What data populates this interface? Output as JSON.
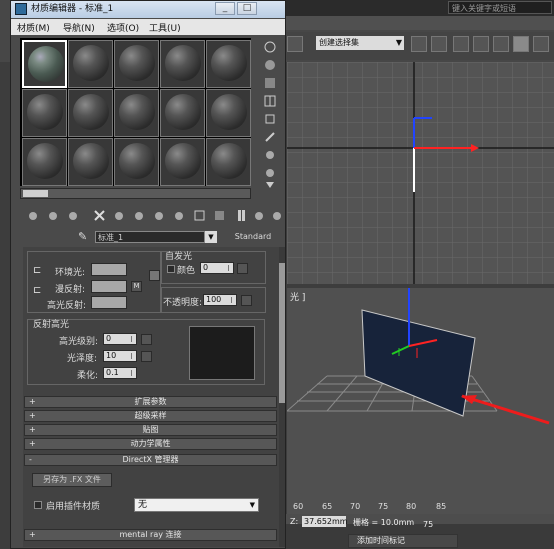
{
  "background": {
    "search_placeholder": "键入关键字或短语",
    "selection_set": "创建选择集",
    "viewport_label": "光 ]",
    "timeline_ticks": [
      "60",
      "65",
      "70",
      "75",
      "80",
      "85"
    ],
    "coord_label": "Z:",
    "coord_value": "37.652mm",
    "grid_label": "栅格 = 10.0mm",
    "add_time_tag": "添加时间标记",
    "extra_tick": "75"
  },
  "material_editor": {
    "title": "材质编辑器 - 标准_1",
    "window_buttons": [
      "_",
      "□"
    ],
    "menus": [
      "材质(M)",
      "导航(N)",
      "选项(O)",
      "工具(U)"
    ],
    "material_name": "标准_1",
    "material_type": "Standard",
    "params": {
      "ambient_label": "环境光:",
      "diffuse_label": "漫反射:",
      "specular_label": "高光反射:",
      "map_button": "M",
      "self_illum_title": "自发光",
      "color_label": "颜色",
      "self_illum_value": "0",
      "opacity_label": "不透明度:",
      "opacity_value": "100",
      "specular_highlights_title": "反射高光",
      "spec_level_label": "高光级别:",
      "spec_level_value": "0",
      "glossiness_label": "光泽度:",
      "glossiness_value": "10",
      "soften_label": "柔化:",
      "soften_value": "0.1"
    },
    "rollouts": {
      "extended": "扩展参数",
      "supersampling": "超级采样",
      "maps": "贴图",
      "dynamics": "动力学属性",
      "directx": "DirectX 管理器",
      "mental_ray": "mental ray 连接"
    },
    "directx": {
      "save_fx_button": "另存为 .FX 文件",
      "enable_plugin_label": "启用插件材质",
      "plugin_value": "无"
    }
  }
}
